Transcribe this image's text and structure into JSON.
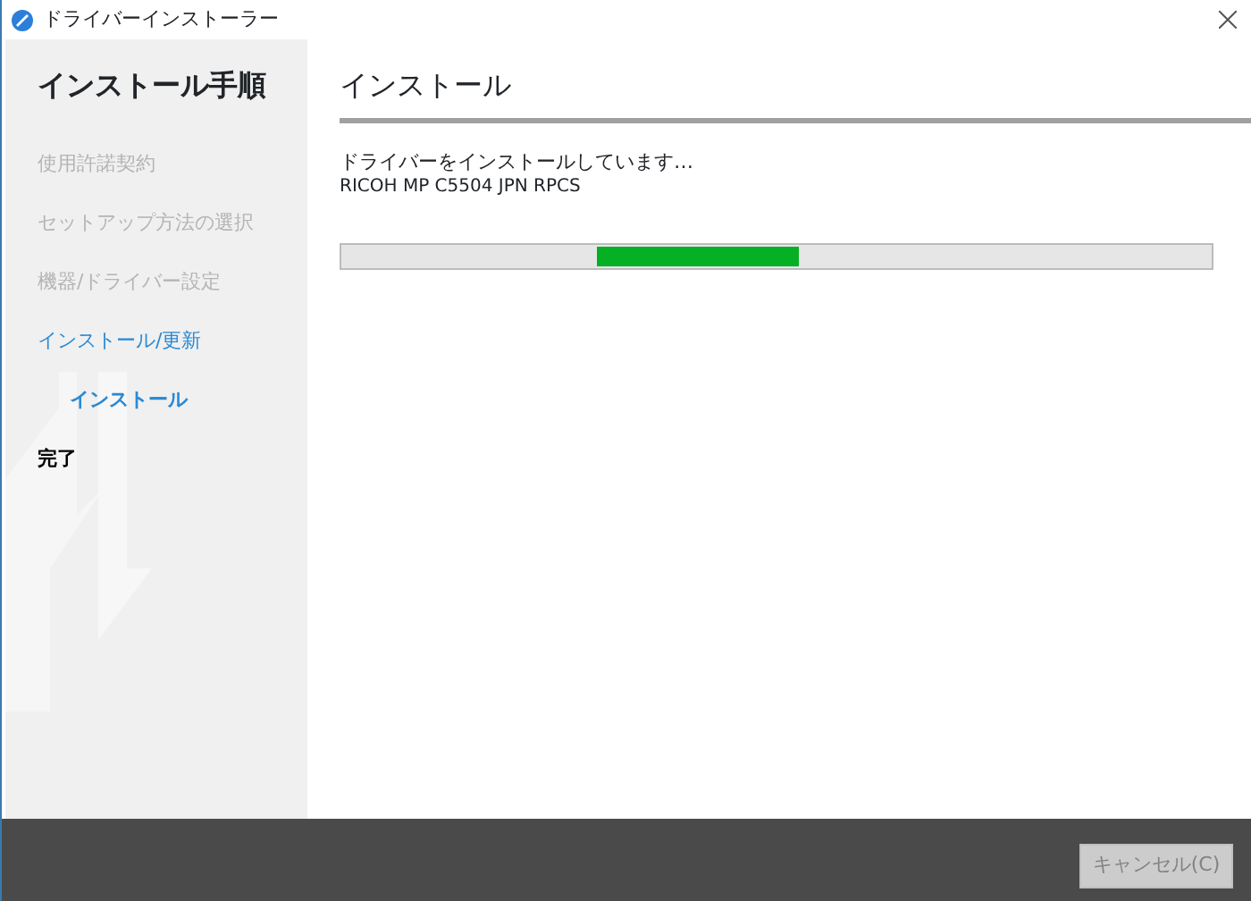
{
  "window": {
    "title": "ドライバーインストーラー"
  },
  "sidebar": {
    "title": "インストール手順",
    "steps": [
      {
        "label": "使用許諾契約",
        "kind": "done"
      },
      {
        "label": "セットアップ方法の選択",
        "kind": "done"
      },
      {
        "label": "機器/ドライバー設定",
        "kind": "done"
      },
      {
        "label": "インストール/更新",
        "kind": "current",
        "children": [
          {
            "label": "インストール",
            "kind": "current"
          }
        ]
      },
      {
        "label": "完了",
        "kind": "pending"
      }
    ]
  },
  "main": {
    "title": "インストール",
    "message": "ドライバーをインストールしています…",
    "device": "RICOH MP C5504 JPN RPCS",
    "progress": {
      "kind": "marquee"
    }
  },
  "buttons": [
    {
      "label": "キャンセル(C)",
      "disabled": true
    }
  ]
}
